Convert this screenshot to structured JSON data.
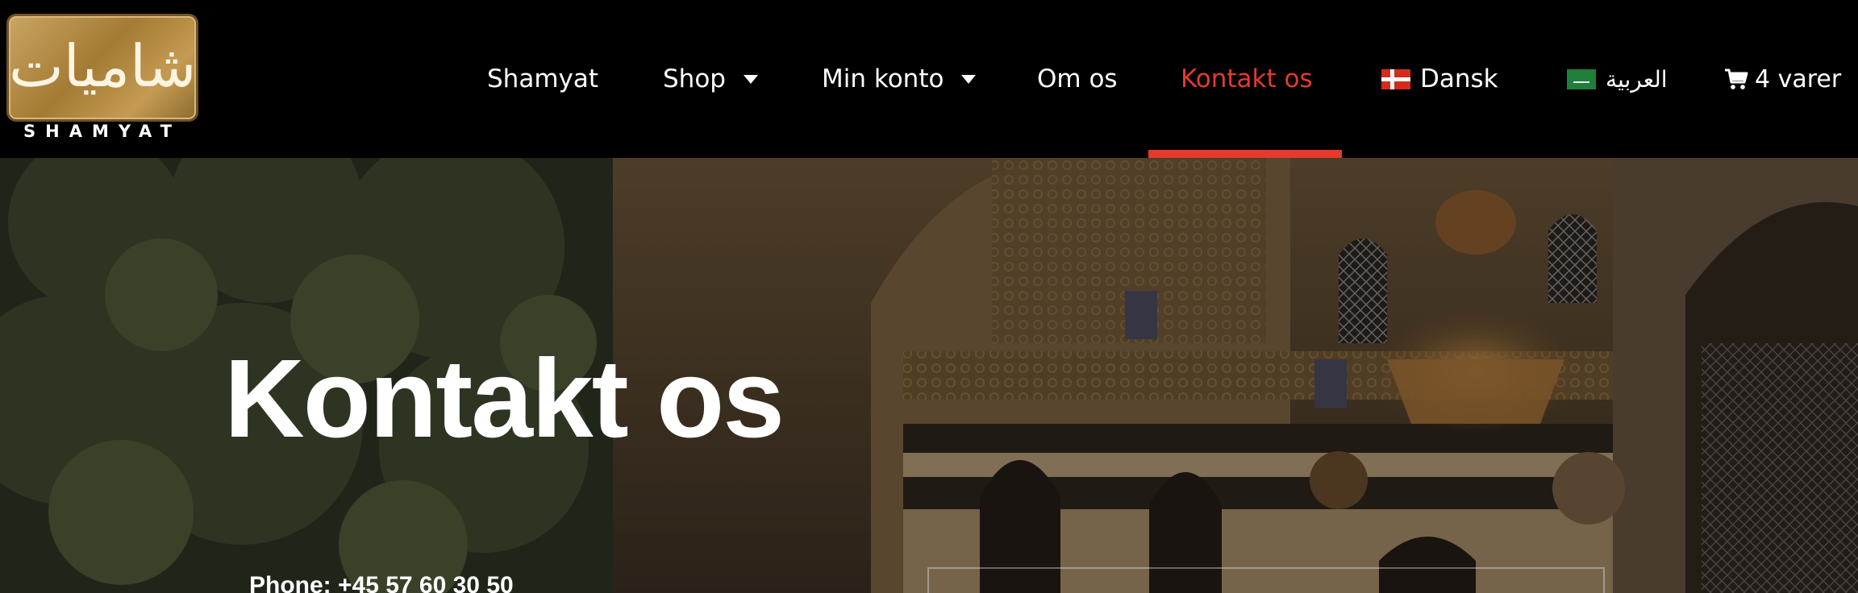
{
  "logo": {
    "arabic_mark": "شاميات",
    "text": "SHAMYAT"
  },
  "nav": {
    "items": [
      {
        "label": "Shamyat"
      },
      {
        "label": "Shop"
      },
      {
        "label": "Min konto"
      },
      {
        "label": "Om os"
      },
      {
        "label": "Kontakt os"
      }
    ],
    "active_item": "Kontakt os",
    "language_da": "Dansk",
    "language_ar": "العربية",
    "cart": "4 varer"
  },
  "hero": {
    "title": "Kontakt os",
    "phone": "Phone: +45 57 60 30 50"
  },
  "colors": {
    "accent": "#e53a2c",
    "header_bg": "#000000",
    "logo_gold": "#b88d45"
  },
  "icons": [
    "caret-down-icon",
    "denmark-flag-icon",
    "saudi-flag-icon",
    "cart-icon"
  ]
}
